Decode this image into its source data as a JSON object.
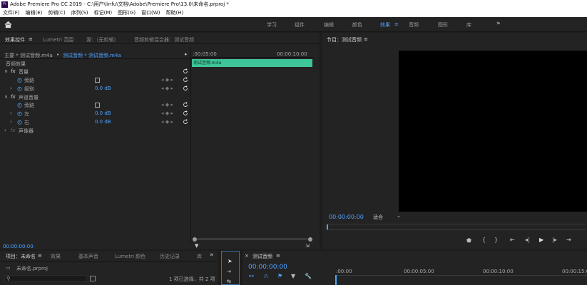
{
  "title_bar": {
    "app_icon": "Pr",
    "title": "Adobe Premiere Pro CC 2019 - C:\\用户\\linfu\\文档\\Adobe\\Premiere Pro\\13.0\\未命名.prproj *"
  },
  "menu": [
    "文件(F)",
    "编辑(E)",
    "剪辑(C)",
    "序列(S)",
    "标记(M)",
    "图形(G)",
    "窗口(W)",
    "帮助(H)"
  ],
  "workspaces": {
    "items": [
      "学习",
      "组件",
      "编辑",
      "颜色",
      "效果",
      "音频",
      "图形",
      "库"
    ],
    "active": "效果",
    "overflow": "»",
    "menu_glyph": "≡"
  },
  "effect_controls": {
    "tabs": [
      "效果控件",
      "Lumetri 范围",
      "源：（无剪辑）",
      "音频剪辑混合器：测试音频"
    ],
    "tab_menu": "≡",
    "source_path": {
      "master": "主要 * 测试音频.m4a",
      "clip": "测试音频 * 测试音频.m4a"
    },
    "timeline_start": ":00:05:00",
    "timeline_end": "00:00:10:00",
    "clip_name": "测试音频.m4a",
    "section_label": "音频效果",
    "fx_glyph": "fx",
    "rows": {
      "volume": "音量",
      "bypass1": "旁路",
      "level": "级别",
      "level_value": "0.0 dB",
      "channel_volume": "声道音量",
      "bypass2": "旁路",
      "left": "左",
      "left_value": "0.0 dB",
      "right": "右",
      "right_value": "0.0 dB",
      "panner": "声像器"
    },
    "timecode": "00:00:00:00"
  },
  "program_monitor": {
    "title": "节目：测试音频",
    "menu_glyph": "≡",
    "timecode": "00:00:00:00",
    "fit": "适合"
  },
  "project_panel": {
    "tabs": [
      "项目：未命名",
      "效果",
      "基本声音",
      "Lumetri 颜色",
      "历史记录",
      "库"
    ],
    "overflow": "»",
    "project_file": "未命名.prproj",
    "selection_status": "1 项已选择，共 2 项"
  },
  "timeline_panel": {
    "tab": "测试音频",
    "close_glyph": "×",
    "menu_glyph": "≡",
    "timecode": "00:00:00:00",
    "ruler": [
      ":00:00",
      "00:00:05:00",
      "00:00:10:00",
      "00:00:15:00"
    ]
  },
  "colors": {
    "accent": "#4ea1ff",
    "clip": "#3ec59a",
    "panel": "#232323",
    "background": "#1d1d1d"
  }
}
